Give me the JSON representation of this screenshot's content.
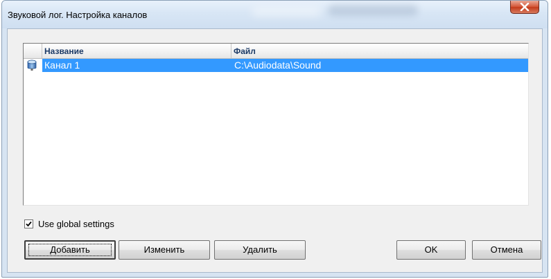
{
  "window": {
    "title": "Звуковой лог. Настройка каналов",
    "close_icon": "close-icon"
  },
  "listview": {
    "columns": [
      "",
      "Название",
      "Файл"
    ],
    "rows": [
      {
        "icon": "channel-icon",
        "name": "Канал 1",
        "file": "C:\\Audiodata\\Sound",
        "selected": true
      }
    ],
    "selection_color": "#3399ff"
  },
  "options": {
    "use_global_settings_label": "Use global settings",
    "use_global_settings_checked": true
  },
  "buttons": {
    "add": "Добавить",
    "edit": "Изменить",
    "delete": "Удалить",
    "ok": "OK",
    "cancel": "Отмена"
  }
}
